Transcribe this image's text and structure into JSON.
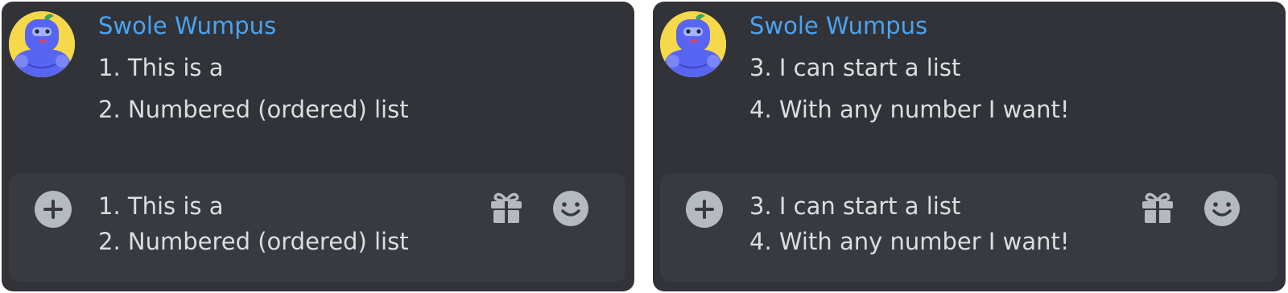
{
  "colors": {
    "panel_bg": "#313338",
    "composer_bg": "#383a40",
    "username": "#4aa3f1",
    "message_text": "#dbdee1",
    "icon": "#b5bac1"
  },
  "panels": [
    {
      "author": {
        "avatar_icon": "wumpus-avatar-icon",
        "name": "Swole Wumpus"
      },
      "message_lines": [
        "1. This is a",
        "2. Numbered (ordered) list"
      ],
      "composer": {
        "lines": [
          "1. This is a",
          "2. Numbered (ordered) list"
        ],
        "attach_icon": "plus-circle-icon",
        "gift_icon": "gift-icon",
        "emoji_icon": "smile-icon"
      }
    },
    {
      "author": {
        "avatar_icon": "wumpus-avatar-icon",
        "name": "Swole Wumpus"
      },
      "message_lines": [
        "3. I can start a list",
        "4. With any number I want!"
      ],
      "composer": {
        "lines": [
          "3. I can start a list",
          "4. With any number I want!"
        ],
        "attach_icon": "plus-circle-icon",
        "gift_icon": "gift-icon",
        "emoji_icon": "smile-icon"
      }
    }
  ]
}
